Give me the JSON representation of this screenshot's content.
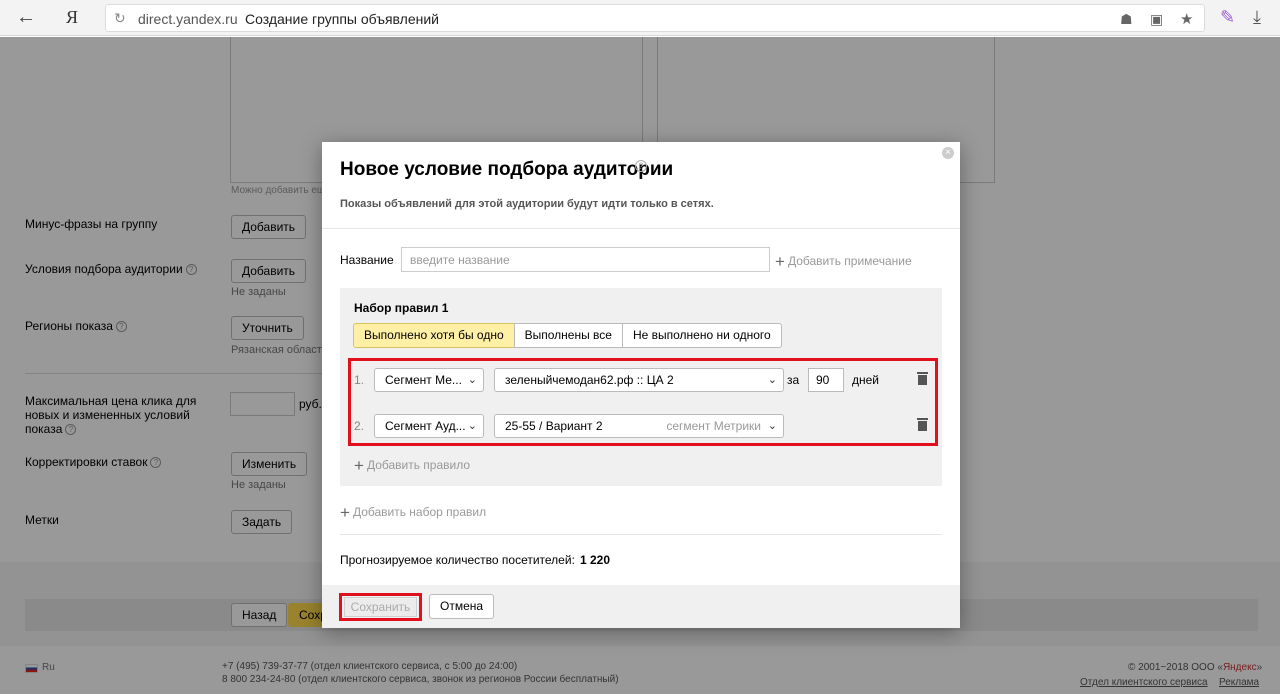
{
  "browser": {
    "back_icon": "arrow-left-icon",
    "brand": "Я",
    "domain": "direct.yandex.ru",
    "title": "Создание группы объявлений"
  },
  "page": {
    "hint_small": "Можно добавить ещ",
    "minus_phrases": {
      "label": "Минус-фразы на группу",
      "button": "Добавить"
    },
    "audience": {
      "label": "Условия подбора аудитории",
      "button": "Добавить",
      "note": "Не заданы"
    },
    "regions": {
      "label": "Регионы показа",
      "button": "Уточнить",
      "note": "Рязанская область"
    },
    "max_price": {
      "label_lines": [
        "Максимальная цена клика для",
        "новых и измененных условий",
        "показа"
      ],
      "unit": "руб."
    },
    "bid_adjust": {
      "label": "Корректировки ставок",
      "button": "Изменить",
      "note": "Не заданы"
    },
    "tags": {
      "label": "Метки",
      "button": "Задать"
    },
    "bottom": {
      "back": "Назад",
      "save": "Сохр"
    }
  },
  "footer": {
    "lang": "Ru",
    "phone1": "+7 (495) 739-37-77 (отдел клиентского сервиса, с 5:00 до 24:00)",
    "phone2": "8 800 234-24-80 (отдел клиентского сервиса, звонок из регионов России бесплатный)",
    "copyright_prefix": "© 2001−2018 ООО «",
    "copyright_brand": "Яндекс",
    "copyright_suffix": "»",
    "link_service": "Отдел клиентского сервиса",
    "link_ads": "Реклама"
  },
  "modal": {
    "title": "Новое условие подбора аудитории",
    "description": "Показы объявлений для этой аудитории будут идти только в сетях.",
    "name_label": "Название",
    "name_placeholder": "введите название",
    "add_note": "Добавить примечание",
    "ruleset": {
      "title": "Набор правил 1",
      "tabs": [
        {
          "label": "Выполнено хотя бы одно",
          "active": true
        },
        {
          "label": "Выполнены все",
          "active": false
        },
        {
          "label": "Не выполнено ни одного",
          "active": false
        }
      ],
      "rules": [
        {
          "num": "1.",
          "type": "Сегмент Ме...",
          "value": "зеленыйчемодан62.рф :: ЦА 2",
          "za": "за",
          "days_value": "90",
          "days_label": "дней"
        },
        {
          "num": "2.",
          "type": "Сегмент Ауд...",
          "value": "25-55 / Вариант 2",
          "value_extra": "сегмент Метрики"
        }
      ],
      "add_rule": "Добавить правило"
    },
    "add_ruleset": "Добавить набор правил",
    "forecast_label": "Прогнозируемое количество посетителей:",
    "forecast_value": "1 220",
    "save": "Сохранить",
    "cancel": "Отмена",
    "highlight_color": "#e0111c"
  }
}
